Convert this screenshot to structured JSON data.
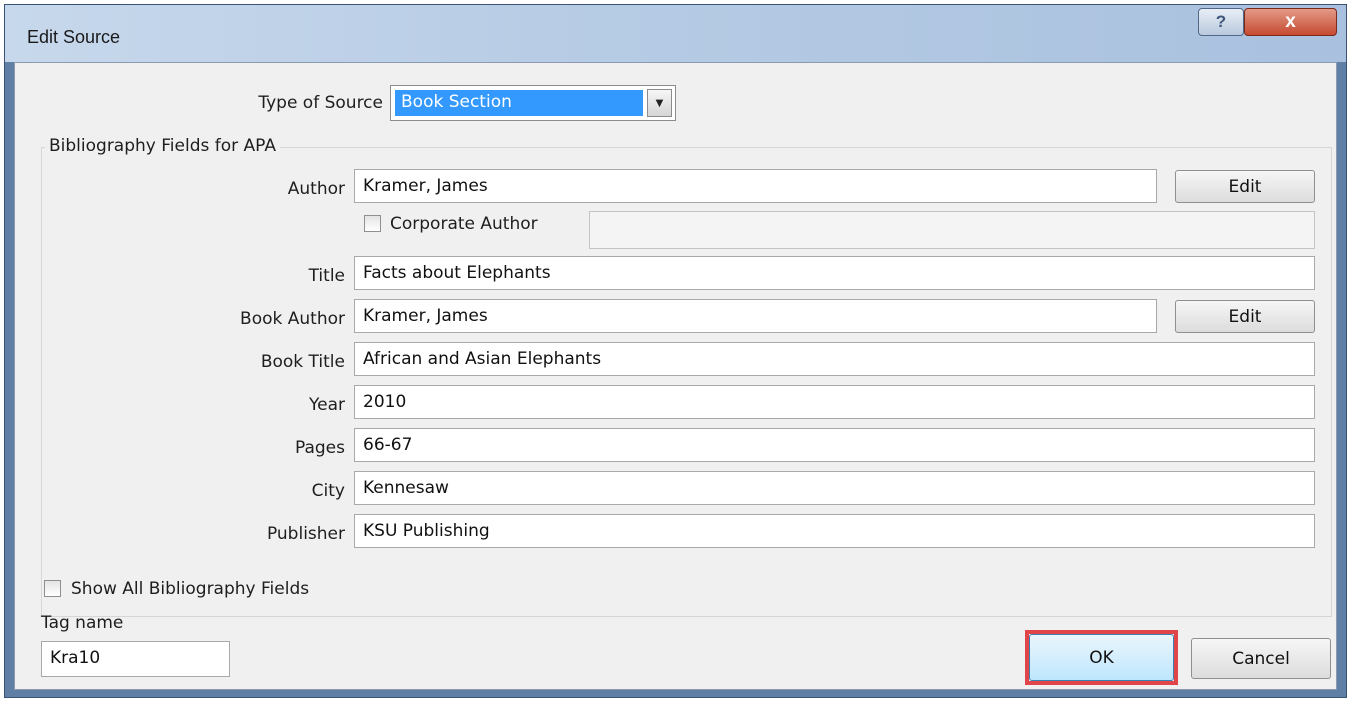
{
  "window": {
    "title": "Edit Source",
    "help_label": "?",
    "close_label": "x"
  },
  "type_of_source": {
    "label": "Type of Source",
    "value": "Book Section"
  },
  "group_label": "Bibliography Fields for APA",
  "author": {
    "label": "Author",
    "value": "Kramer, James",
    "edit_label": "Edit"
  },
  "corporate_author": {
    "label": "Corporate Author",
    "checked": false,
    "value": ""
  },
  "fields": [
    {
      "label": "Title",
      "value": "Facts about Elephants"
    },
    {
      "label": "Book Author",
      "value": "Kramer, James"
    },
    {
      "label": "Book Title",
      "value": "African and Asian Elephants"
    },
    {
      "label": "Year",
      "value": "2010"
    },
    {
      "label": "Pages",
      "value": "66-67"
    },
    {
      "label": "City",
      "value": "Kennesaw"
    },
    {
      "label": "Publisher",
      "value": "KSU Publishing"
    }
  ],
  "book_author_edit_label": "Edit",
  "show_all": {
    "label": "Show All Bibliography Fields",
    "checked": false
  },
  "tag": {
    "label": "Tag name",
    "value": "Kra10"
  },
  "buttons": {
    "ok": "OK",
    "cancel": "Cancel"
  },
  "colors": {
    "selection": "#3399ff",
    "highlight": "#e0454a",
    "titlebar": "#b6cbe4"
  }
}
